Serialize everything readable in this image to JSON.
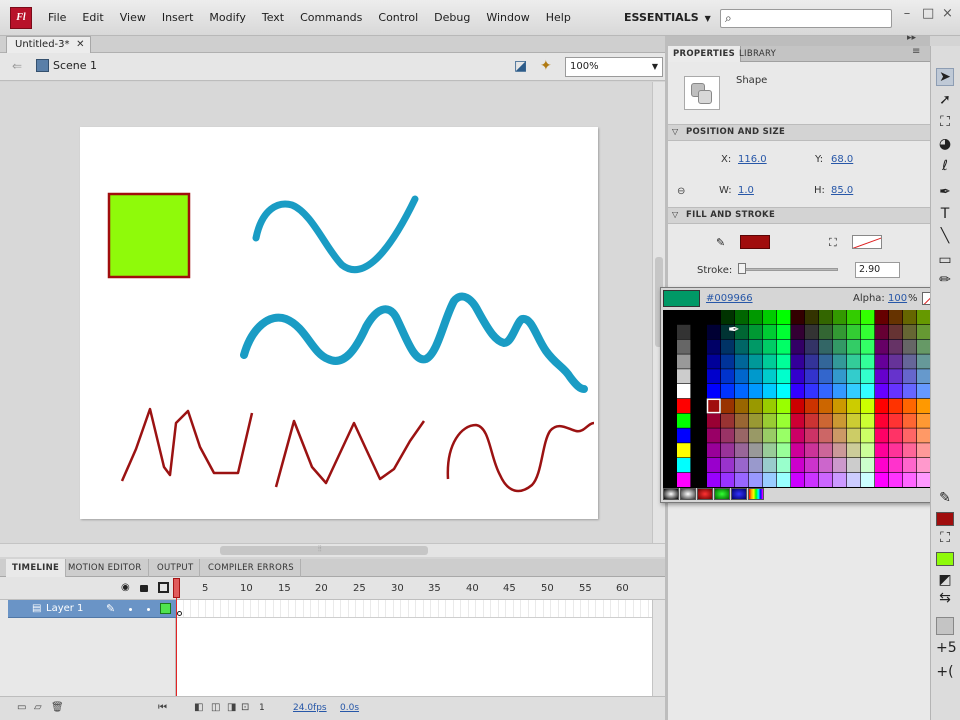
{
  "app": {
    "logo": "Fl"
  },
  "menu": [
    "File",
    "Edit",
    "View",
    "Insert",
    "Modify",
    "Text",
    "Commands",
    "Control",
    "Debug",
    "Window",
    "Help"
  ],
  "workspace": {
    "label": "ESSENTIALS",
    "search_placeholder": ""
  },
  "document": {
    "tab": "Untitled-3*",
    "scene": "Scene 1",
    "zoom": "100%"
  },
  "stage": {
    "background": "#ffffff",
    "rect": {
      "fill": "#8ffa0a",
      "stroke": "#a00d0d"
    },
    "blue_color": "#1a9cc4",
    "red_color": "#9b1212"
  },
  "timeline": {
    "tabs": [
      "TIMELINE",
      "MOTION EDITOR",
      "OUTPUT",
      "COMPILER ERRORS"
    ],
    "frame_numbers": [
      "5",
      "10",
      "15",
      "20",
      "25",
      "30",
      "35",
      "40",
      "45",
      "50",
      "55",
      "60"
    ],
    "layer": {
      "name": "Layer 1",
      "color": "#4fe34f"
    },
    "footer": {
      "frame": "1",
      "fps": "24.0fps",
      "time": "0.0s"
    }
  },
  "properties": {
    "tabs": [
      "PROPERTIES",
      "LIBRARY"
    ],
    "object_type": "Shape",
    "position_section": "POSITION AND SIZE",
    "x_label": "X:",
    "x_value": "116.0",
    "y_label": "Y:",
    "y_value": "68.0",
    "w_label": "W:",
    "w_value": "1.0",
    "h_label": "H:",
    "h_value": "85.0",
    "fill_section": "FILL AND STROKE",
    "stroke_label": "Stroke:",
    "stroke_value": "2.90",
    "stroke_color": "#a00d0d"
  },
  "color_picker": {
    "hex": "#009966",
    "alpha_label": "Alpha:",
    "alpha_value": "100",
    "alpha_unit": "%",
    "selected": "#a00d0d"
  },
  "tools": [
    "selection",
    "subselection",
    "free-transform",
    "3d-rotation",
    "lasso",
    "pen",
    "text",
    "line",
    "rectangle",
    "pencil"
  ]
}
